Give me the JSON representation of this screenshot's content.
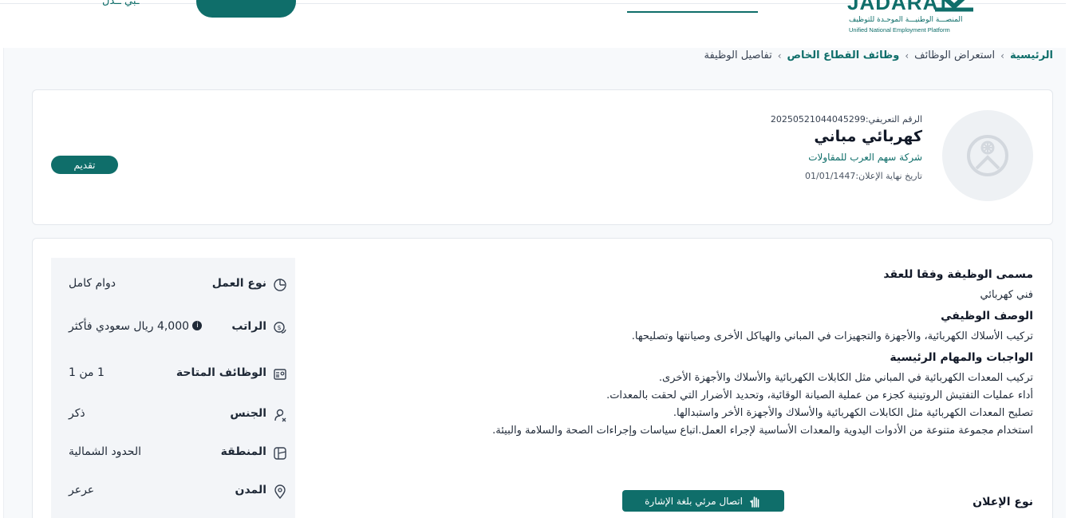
{
  "header": {
    "logo_text": "JADARAT",
    "logo_subtitle_ar": "المنصـــة الوطنيـــة الموحـدة للتوظيف",
    "logo_subtitle_en": "Unified National Employment Platform"
  },
  "breadcrumb": {
    "items": [
      {
        "label": "الرئيسية",
        "link": true
      },
      {
        "label": "استعراض الوظائف",
        "link": false
      },
      {
        "label": "وظائف القطاع الخاص",
        "link": true
      },
      {
        "label": "تفاصيل الوظيفة",
        "link": false
      }
    ],
    "separator": "›"
  },
  "job": {
    "reference": "الرقم التعريفي:20250521044045299",
    "title": "كهربائي مباني",
    "company": "شركة سهم العرب للمقاولات",
    "deadline": "تاريخ نهاية الإعلان:01/01/1447",
    "apply_label": "تقديم"
  },
  "attributes": [
    {
      "icon": "clock-icon",
      "label": "نوع العمل",
      "value": "دوام كامل"
    },
    {
      "icon": "salary-icon",
      "label": "الراتب",
      "value": "4,000 ريال سعودي فأكثر"
    },
    {
      "icon": "id-card-icon",
      "label": "الوظائف المتاحة",
      "value": "1 من 1"
    },
    {
      "icon": "gender-icon",
      "label": "الجنس",
      "value": "ذكر"
    },
    {
      "icon": "map-icon",
      "label": "المنطقة",
      "value": "الحدود الشمالية"
    },
    {
      "icon": "location-pin-icon",
      "label": "المدن",
      "value": "عرعر"
    }
  ],
  "description": {
    "contract_title_label": "مسمى الوظيفة وفقا للعقد",
    "contract_title_value": "فني كهربائي",
    "job_desc_label": "الوصف الوظيفي",
    "job_desc_value": "تركيب الأسلاك الكهربائية، والأجهزة والتجهيزات في المباني والهياكل الأخرى وصيانتها وتصليحها.",
    "duties_label": "الواجبات والمهام الرئيسية",
    "duties": [
      "تركيب المعدات الكهربائية في المباني مثل الكابلات الكهربائية والأسلاك والأجهزة الأخرى.",
      "أداء عمليات التفتيش الروتينية كجزء من عملية الصيانة الوقائية، وتحديد الأضرار التي لحقت بالمعدات.",
      "تصليح المعدات الكهربائية مثل الكابلات الكهربائية والأسلاك والأجهزة الأخر واستبدالها.",
      "استخدام مجموعة متنوعة من الأدوات اليدوية والمعدات الأساسية لإجراء العمل.اتباع سياسات وإجراءات الصحة والسلامة والبيئة."
    ],
    "ad_type_label": "نوع الإعلان",
    "sign_language_label": "اتصال مرئي بلغة الإشارة"
  },
  "colors": {
    "brand": "#0f6e6a",
    "panel": "#f3f5f8"
  }
}
